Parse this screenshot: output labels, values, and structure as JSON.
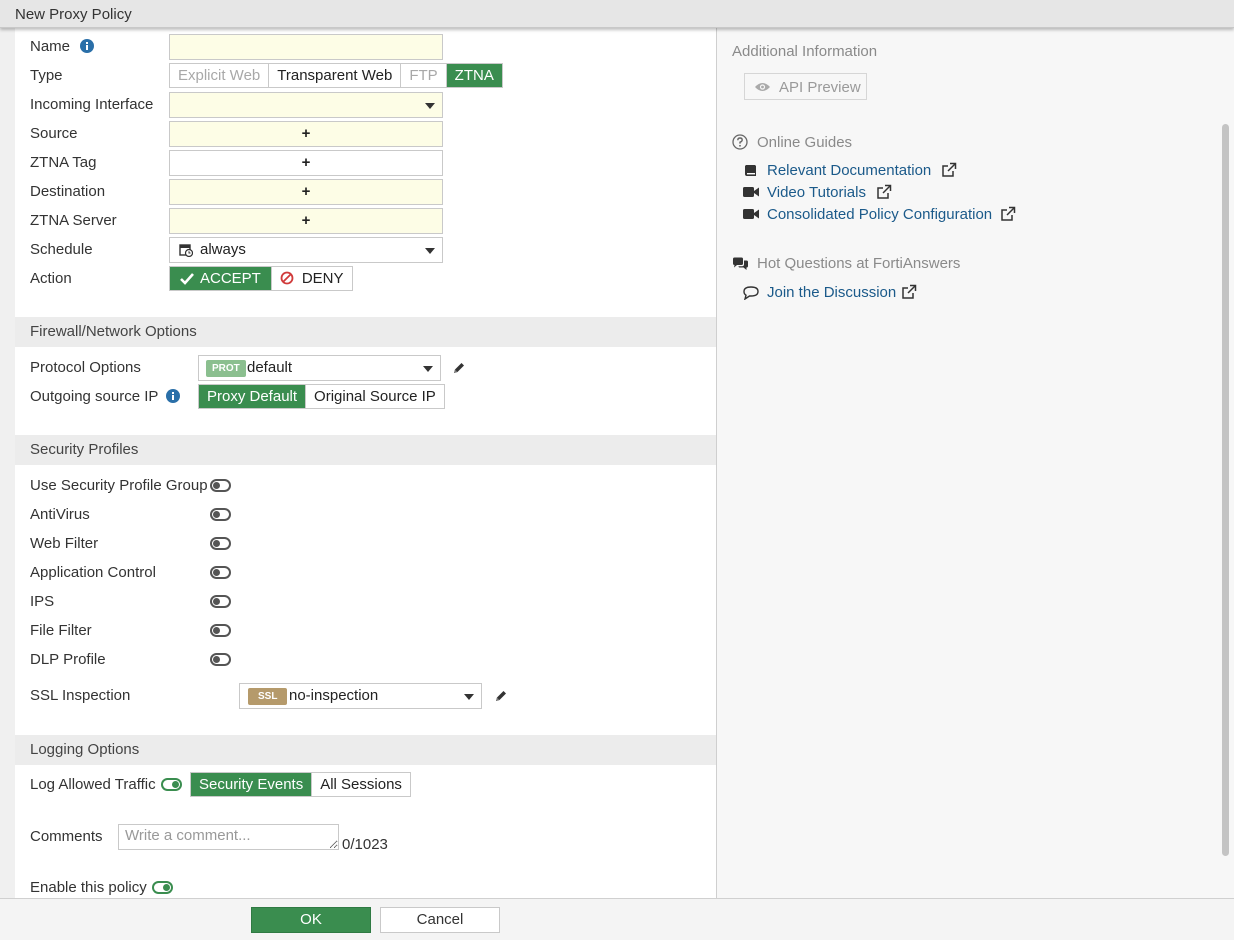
{
  "window": {
    "title": "New Proxy Policy"
  },
  "form": {
    "name_label": "Name",
    "type_label": "Type",
    "type_options": [
      "Explicit Web",
      "Transparent Web",
      "FTP",
      "ZTNA"
    ],
    "incoming_label": "Incoming Interface",
    "source_label": "Source",
    "ztna_tag_label": "ZTNA Tag",
    "destination_label": "Destination",
    "ztna_server_label": "ZTNA Server",
    "schedule_label": "Schedule",
    "schedule_value": "always",
    "action_label": "Action",
    "accept_label": "ACCEPT",
    "deny_label": "DENY",
    "plus": "+"
  },
  "firewall": {
    "header": "Firewall/Network Options",
    "protocol_label": "Protocol Options",
    "protocol_badge": "PROT",
    "protocol_value": "default",
    "outgoing_label": "Outgoing source IP",
    "outgoing_options": [
      "Proxy Default",
      "Original Source IP"
    ]
  },
  "security": {
    "header": "Security Profiles",
    "items": [
      "Use Security Profile Group",
      "AntiVirus",
      "Web Filter",
      "Application Control",
      "IPS",
      "File Filter",
      "DLP Profile"
    ],
    "ssl_label": "SSL Inspection",
    "ssl_badge": "SSL",
    "ssl_value": "no-inspection"
  },
  "logging": {
    "header": "Logging Options",
    "log_label": "Log Allowed Traffic",
    "log_options": [
      "Security Events",
      "All Sessions"
    ],
    "comments_label": "Comments",
    "comments_placeholder": "Write a comment...",
    "comments_count": "0/1023",
    "enable_label": "Enable this policy"
  },
  "footer": {
    "ok": "OK",
    "cancel": "Cancel"
  },
  "sidebar": {
    "additional_info": "Additional Information",
    "api_preview": "API Preview",
    "online_guides": "Online Guides",
    "guides": [
      "Relevant Documentation",
      "Video Tutorials",
      "Consolidated Policy Configuration"
    ],
    "hot_questions": "Hot Questions at FortiAnswers",
    "join": "Join the Discussion"
  },
  "colors": {
    "accent_green": "#3a8d4f",
    "link_blue": "#1b5a8a",
    "required_yellow": "#fdfde6",
    "prot_badge": "#8bbf8f",
    "ssl_badge": "#b59a6b"
  }
}
